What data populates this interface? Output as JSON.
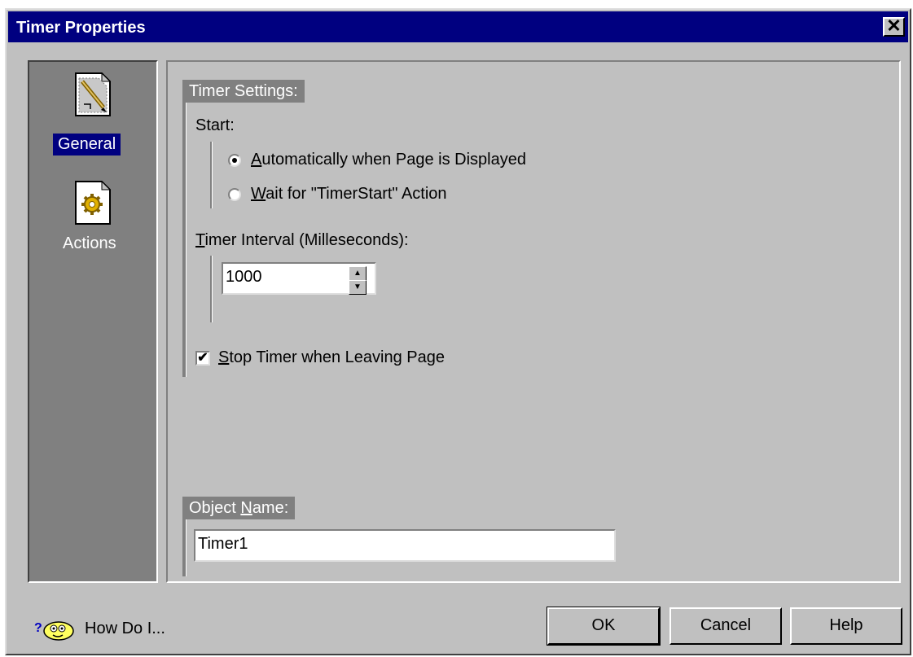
{
  "window": {
    "title": "Timer Properties",
    "close_icon": "close-icon"
  },
  "nav": {
    "items": [
      {
        "label": "General",
        "icon": "general-page-icon",
        "selected": true
      },
      {
        "label": "Actions",
        "icon": "actions-gear-page-icon",
        "selected": false
      }
    ]
  },
  "timer_settings": {
    "header": "Timer Settings:",
    "start_label": "Start:",
    "radio_auto": {
      "pre": "",
      "accel": "A",
      "post": "utomatically when Page is Displayed",
      "checked": true
    },
    "radio_wait": {
      "pre": "",
      "accel": "W",
      "post": "ait for \"TimerStart\" Action",
      "checked": false
    },
    "interval_label": {
      "accel": "T",
      "post": "imer Interval (Milleseconds):"
    },
    "interval_value": "1000",
    "stop_checkbox": {
      "accel": "S",
      "post": "top Timer when Leaving Page",
      "checked": true
    }
  },
  "object_name": {
    "header_pre": "Object ",
    "header_accel": "N",
    "header_post": "ame:",
    "value": "Timer1"
  },
  "footer": {
    "help_link": "How Do I...",
    "ok_label": "OK",
    "cancel_label": "Cancel",
    "help_label": "Help"
  },
  "colors": {
    "title_bar": "#000080",
    "face": "#c0c0c0",
    "nav_bg": "#808080",
    "selection": "#000080"
  }
}
